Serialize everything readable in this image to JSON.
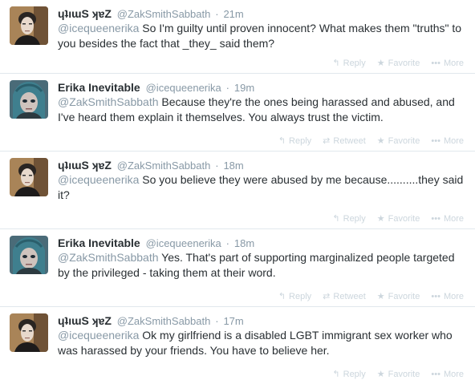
{
  "tweets": [
    {
      "fullname": "ɥʇıɯS ʞɐZ",
      "username": "@ZakSmithSabbath",
      "separator": "·",
      "time": "21m",
      "mention": "@icequeenerika",
      "text": " So I'm guilty until proven innocent? What makes them \"truths\" to you besides the fact that _they_ said them?",
      "avatar": "zak",
      "actions": {
        "reply": "Reply",
        "favorite": "Favorite",
        "more": "More"
      }
    },
    {
      "fullname": "Erika Inevitable",
      "username": "@icequeenerika",
      "separator": "·",
      "time": "19m",
      "mention": "@ZakSmithSabbath",
      "text": " Because they're the ones being harassed and abused, and I've heard them explain it themselves. You always trust the victim.",
      "avatar": "erika",
      "actions": {
        "reply": "Reply",
        "retweet": "Retweet",
        "favorite": "Favorite",
        "more": "More"
      }
    },
    {
      "fullname": "ɥʇıɯS ʞɐZ",
      "username": "@ZakSmithSabbath",
      "separator": "·",
      "time": "18m",
      "mention": "@icequeenerika",
      "text": " So you believe they were abused by me because..........they said it?",
      "avatar": "zak",
      "actions": {
        "reply": "Reply",
        "favorite": "Favorite",
        "more": "More"
      }
    },
    {
      "fullname": "Erika Inevitable",
      "username": "@icequeenerika",
      "separator": "·",
      "time": "18m",
      "mention": "@ZakSmithSabbath",
      "text": " Yes. That's part of supporting marginalized people targeted by the privileged - taking them at their word.",
      "avatar": "erika",
      "actions": {
        "reply": "Reply",
        "retweet": "Retweet",
        "favorite": "Favorite",
        "more": "More"
      }
    },
    {
      "fullname": "ɥʇıɯS ʞɐZ",
      "username": "@ZakSmithSabbath",
      "separator": "·",
      "time": "17m",
      "mention": "@icequeenerika",
      "text": " Ok my girlfriend is a disabled LGBT immigrant sex worker who was harassed by your friends. You have to believe her.",
      "avatar": "zak",
      "actions": {
        "reply": "Reply",
        "favorite": "Favorite",
        "more": "More"
      }
    }
  ],
  "colors": {
    "text": "#292f33",
    "muted": "#8899a6",
    "action": "#ccd6dd",
    "divider": "#e1e8ed"
  }
}
